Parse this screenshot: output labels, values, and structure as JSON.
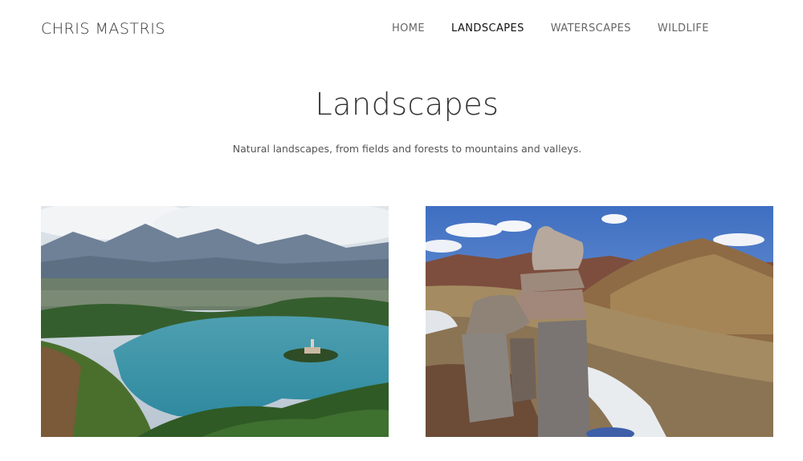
{
  "header": {
    "brand": "CHRIS MASTRIS",
    "nav": [
      {
        "label": "HOME",
        "active": false
      },
      {
        "label": "LANDSCAPES",
        "active": true
      },
      {
        "label": "WATERSCAPES",
        "active": false
      },
      {
        "label": "WILDLIFE",
        "active": false
      }
    ]
  },
  "main": {
    "title": "Landscapes",
    "subtitle": "Natural landscapes, from fields and forests to mountains and valleys."
  },
  "colors": {
    "text": "#333333",
    "nav_inactive": "#666666",
    "nav_active": "#111111",
    "background": "#ffffff"
  }
}
